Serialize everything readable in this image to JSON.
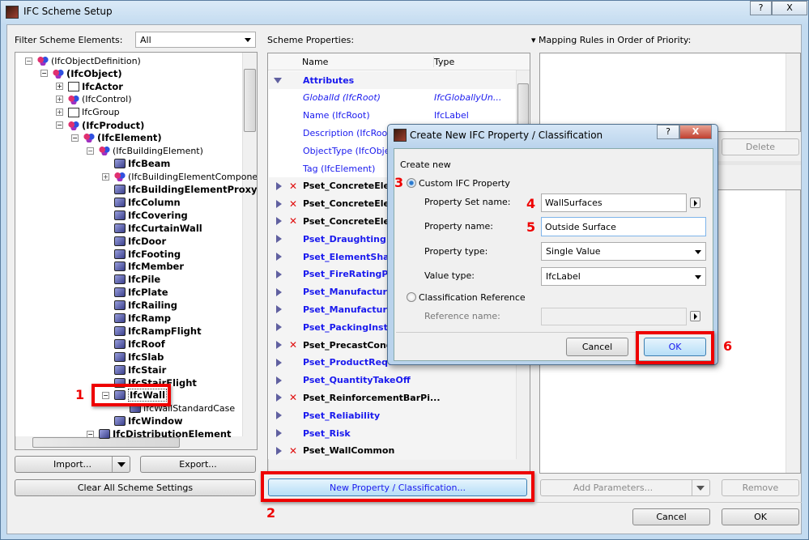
{
  "window": {
    "title": "IFC Scheme Setup",
    "help": "?",
    "close": "X"
  },
  "filter": {
    "label": "Filter Scheme Elements:",
    "value": "All"
  },
  "tree": [
    {
      "label": "(IfcObjectDefinition)",
      "level": 0,
      "bold": false,
      "exp": "-",
      "icon": "multi"
    },
    {
      "label": "(IfcObject)",
      "level": 1,
      "bold": true,
      "exp": "-",
      "icon": "multi"
    },
    {
      "label": "IfcActor",
      "level": 2,
      "bold": true,
      "exp": "+",
      "icon": "out"
    },
    {
      "label": "(IfcControl)",
      "level": 2,
      "bold": false,
      "exp": "+",
      "icon": "multi"
    },
    {
      "label": "IfcGroup",
      "level": 2,
      "bold": false,
      "exp": "+",
      "icon": "out"
    },
    {
      "label": "(IfcProduct)",
      "level": 2,
      "bold": true,
      "exp": "-",
      "icon": "multi"
    },
    {
      "label": "(IfcElement)",
      "level": 3,
      "bold": true,
      "exp": "-",
      "icon": "multi"
    },
    {
      "label": "(IfcBuildingElement)",
      "level": 4,
      "bold": false,
      "exp": "-",
      "icon": "multi"
    },
    {
      "label": "IfcBeam",
      "level": 5,
      "bold": true,
      "exp": "",
      "icon": "el"
    },
    {
      "label": "(IfcBuildingElementComponen",
      "level": 5,
      "bold": false,
      "exp": "+",
      "icon": "multi"
    },
    {
      "label": "IfcBuildingElementProxy",
      "level": 5,
      "bold": true,
      "exp": "",
      "icon": "el"
    },
    {
      "label": "IfcColumn",
      "level": 5,
      "bold": true,
      "exp": "",
      "icon": "el"
    },
    {
      "label": "IfcCovering",
      "level": 5,
      "bold": true,
      "exp": "",
      "icon": "el"
    },
    {
      "label": "IfcCurtainWall",
      "level": 5,
      "bold": true,
      "exp": "",
      "icon": "el"
    },
    {
      "label": "IfcDoor",
      "level": 5,
      "bold": true,
      "exp": "",
      "icon": "el"
    },
    {
      "label": "IfcFooting",
      "level": 5,
      "bold": true,
      "exp": "",
      "icon": "el"
    },
    {
      "label": "IfcMember",
      "level": 5,
      "bold": true,
      "exp": "",
      "icon": "el"
    },
    {
      "label": "IfcPile",
      "level": 5,
      "bold": true,
      "exp": "",
      "icon": "el"
    },
    {
      "label": "IfcPlate",
      "level": 5,
      "bold": true,
      "exp": "",
      "icon": "el"
    },
    {
      "label": "IfcRailing",
      "level": 5,
      "bold": true,
      "exp": "",
      "icon": "el"
    },
    {
      "label": "IfcRamp",
      "level": 5,
      "bold": true,
      "exp": "",
      "icon": "el"
    },
    {
      "label": "IfcRampFlight",
      "level": 5,
      "bold": true,
      "exp": "",
      "icon": "el"
    },
    {
      "label": "IfcRoof",
      "level": 5,
      "bold": true,
      "exp": "",
      "icon": "el"
    },
    {
      "label": "IfcSlab",
      "level": 5,
      "bold": true,
      "exp": "",
      "icon": "el"
    },
    {
      "label": "IfcStair",
      "level": 5,
      "bold": true,
      "exp": "",
      "icon": "el"
    },
    {
      "label": "IfcStairFlight",
      "level": 5,
      "bold": true,
      "exp": "",
      "icon": "el"
    },
    {
      "label": "IfcWall",
      "level": 5,
      "bold": true,
      "exp": "-",
      "icon": "el",
      "selected": true
    },
    {
      "label": "IfcWallStandardCase",
      "level": 6,
      "bold": false,
      "exp": "",
      "icon": "el"
    },
    {
      "label": "IfcWindow",
      "level": 5,
      "bold": true,
      "exp": "",
      "icon": "el"
    },
    {
      "label": "IfcDistributionElement",
      "level": 4,
      "bold": true,
      "exp": "-",
      "icon": "el"
    }
  ],
  "left_buttons": {
    "import": "Import...",
    "export": "Export...",
    "clear": "Clear All Scheme Settings"
  },
  "scheme": {
    "label": "Scheme Properties:",
    "col_name": "Name",
    "col_type": "Type",
    "rows": [
      {
        "name": "Attributes",
        "type": "",
        "kind": "group",
        "expanded": true
      },
      {
        "name": "GlobalId (IfcRoot)",
        "type": "IfcGloballyUn...",
        "kind": "attr",
        "italic": true
      },
      {
        "name": "Name (IfcRoot)",
        "type": "IfcLabel",
        "kind": "attr"
      },
      {
        "name": "Description (IfcRoot)",
        "type": "",
        "kind": "attr"
      },
      {
        "name": "ObjectType (IfcObject",
        "type": "",
        "kind": "attr"
      },
      {
        "name": "Tag (IfcElement)",
        "type": "",
        "kind": "attr"
      },
      {
        "name": "Pset_ConcreteElem",
        "kind": "pset",
        "removed": true
      },
      {
        "name": "Pset_ConcreteElem",
        "kind": "pset",
        "removed": true
      },
      {
        "name": "Pset_ConcreteElem",
        "kind": "pset",
        "removed": true
      },
      {
        "name": "Pset_Draughting",
        "kind": "pset"
      },
      {
        "name": "Pset_ElementShad",
        "kind": "pset"
      },
      {
        "name": "Pset_FireRatingPro",
        "kind": "pset"
      },
      {
        "name": "Pset_Manufacture",
        "kind": "pset"
      },
      {
        "name": "Pset_Manufacture",
        "kind": "pset"
      },
      {
        "name": "Pset_PackingInstr",
        "kind": "pset"
      },
      {
        "name": "Pset_PrecastConcr",
        "kind": "pset",
        "removed": true
      },
      {
        "name": "Pset_ProductRequ",
        "kind": "pset"
      },
      {
        "name": "Pset_QuantityTakeOff",
        "kind": "pset"
      },
      {
        "name": "Pset_ReinforcementBarPi...",
        "kind": "pset",
        "removed": true
      },
      {
        "name": "Pset_Reliability",
        "kind": "pset"
      },
      {
        "name": "Pset_Risk",
        "kind": "pset"
      },
      {
        "name": "Pset_WallCommon",
        "kind": "pset",
        "removed": true
      }
    ],
    "new_button": "New Property / Classification..."
  },
  "mapping": {
    "label": "Mapping Rules in Order of Priority:",
    "delete": "Delete",
    "add_params": "Add Parameters...",
    "remove": "Remove"
  },
  "footer": {
    "cancel": "Cancel",
    "ok": "OK"
  },
  "dialog": {
    "title": "Create New IFC Property / Classification",
    "help": "?",
    "close": "X",
    "create_new": "Create new",
    "custom_option": "Custom IFC Property",
    "pset_label": "Property Set name:",
    "pset_value": "WallSurfaces",
    "prop_label": "Property name:",
    "prop_value": "Outside Surface",
    "ptype_label": "Property type:",
    "ptype_value": "Single Value",
    "vtype_label": "Value type:",
    "vtype_value": "IfcLabel",
    "class_option": "Classification Reference",
    "ref_label": "Reference name:",
    "ref_value": "",
    "cancel": "Cancel",
    "ok": "OK"
  },
  "annotations": [
    "1",
    "2",
    "3",
    "4",
    "5",
    "6"
  ],
  "colors": {
    "pset_blue": "#1a1aee",
    "removed_red": "#e01010",
    "annotation_red": "#ee0000"
  }
}
